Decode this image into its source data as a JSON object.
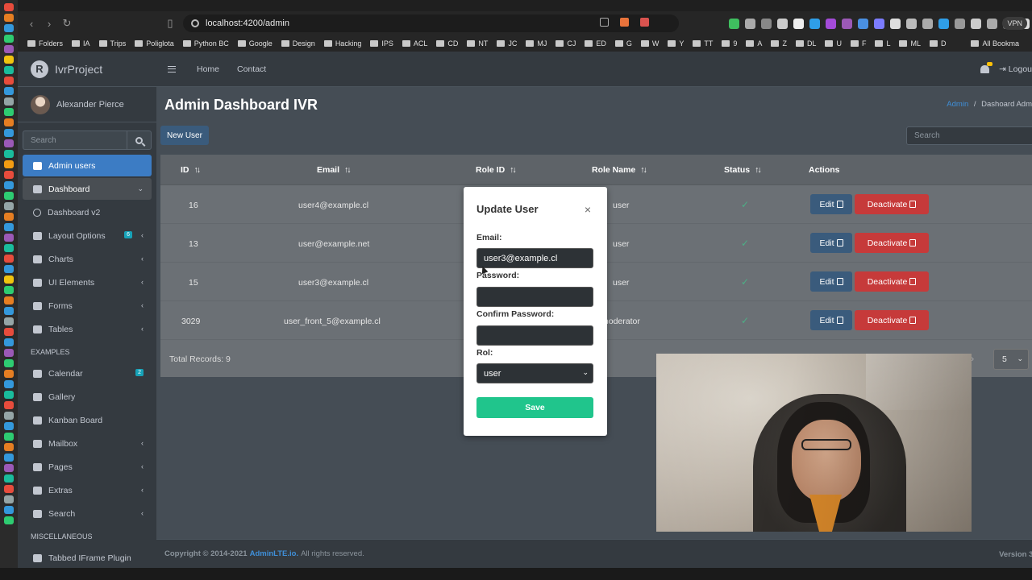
{
  "browser": {
    "url": "localhost:4200/admin",
    "vpn_label": "VPN",
    "bookmarks": [
      "Folders",
      "IA",
      "Trips",
      "Poliglota",
      "Python BC",
      "Google",
      "Design",
      "Hacking",
      "IPS",
      "ACL",
      "CD",
      "NT",
      "JC",
      "MJ",
      "CJ",
      "ED",
      "G",
      "W",
      "Y",
      "TT",
      "9",
      "A",
      "Z",
      "DL",
      "U",
      "F",
      "L",
      "ML",
      "D"
    ],
    "all_bookmarks_label": "All Bookma"
  },
  "app": {
    "brand": "IvrProject",
    "brand_logo_letter": "R",
    "user_name": "Alexander Pierce",
    "sidebar_search_placeholder": "Search",
    "nav": [
      {
        "label": "Admin users",
        "state": "active"
      },
      {
        "label": "Dashboard",
        "state": "open",
        "chevron": "⌄"
      },
      {
        "label": "Dashboard v2",
        "state": "sub"
      },
      {
        "label": "Layout Options",
        "badge": "6",
        "chevron": "‹"
      },
      {
        "label": "Charts",
        "chevron": "‹"
      },
      {
        "label": "UI Elements",
        "chevron": "‹"
      },
      {
        "label": "Forms",
        "chevron": "‹"
      },
      {
        "label": "Tables",
        "chevron": "‹"
      }
    ],
    "examples_header": "EXAMPLES",
    "examples": [
      {
        "label": "Calendar",
        "badge": "2"
      },
      {
        "label": "Gallery"
      },
      {
        "label": "Kanban Board"
      },
      {
        "label": "Mailbox",
        "chevron": "‹"
      },
      {
        "label": "Pages",
        "chevron": "‹"
      },
      {
        "label": "Extras",
        "chevron": "‹"
      },
      {
        "label": "Search",
        "chevron": "‹"
      }
    ],
    "misc_header": "MISCELLANEOUS",
    "misc": [
      {
        "label": "Tabbed IFrame Plugin"
      }
    ],
    "topnav": {
      "home": "Home",
      "contact": "Contact",
      "logout": "Logou"
    },
    "page_title": "Admin Dashboard IVR",
    "breadcrumb": {
      "link": "Admin",
      "sep": "/",
      "current": "Dashoard Adm"
    },
    "new_user_label": "New User",
    "table_search_placeholder": "Search",
    "table": {
      "headers": [
        "ID",
        "Email",
        "Role ID",
        "Role Name",
        "Status",
        "Actions"
      ],
      "sort_symbol": "↑↓",
      "rows": [
        {
          "id": "16",
          "email": "user4@example.cl",
          "role_name": "user",
          "status": "✓"
        },
        {
          "id": "13",
          "email": "user@example.net",
          "role_name": "user",
          "status": "✓"
        },
        {
          "id": "15",
          "email": "user3@example.cl",
          "role_name": "user",
          "status": "✓"
        },
        {
          "id": "3029",
          "email": "user_front_5@example.cl",
          "role_name": "moderator",
          "status": "✓"
        }
      ],
      "edit_label": "Edit",
      "deactivate_label": "Deactivate",
      "total_records": "Total Records: 9",
      "pager_next": "»",
      "page_size": "5"
    },
    "footer": {
      "copyright": "Copyright © 2014-2021",
      "link": "AdminLTE.io.",
      "rights": "All rights reserved.",
      "version": "Version 3."
    }
  },
  "modal": {
    "title": "Update User",
    "close": "×",
    "email_label": "Email:",
    "email_value": "user3@example.cl",
    "password_label": "Password:",
    "password_value": "",
    "confirm_label": "Confirm Password:",
    "confirm_value": "",
    "rol_label": "Rol:",
    "rol_value": "user",
    "save_label": "Save"
  },
  "colors": {
    "sidebar_bg": "#343a40",
    "content_bg": "#454d55",
    "active_nav": "#3c7cc4",
    "primary_btn": "#3a5b7c",
    "danger_btn": "#c63a3a",
    "save_btn": "#20c58c"
  }
}
